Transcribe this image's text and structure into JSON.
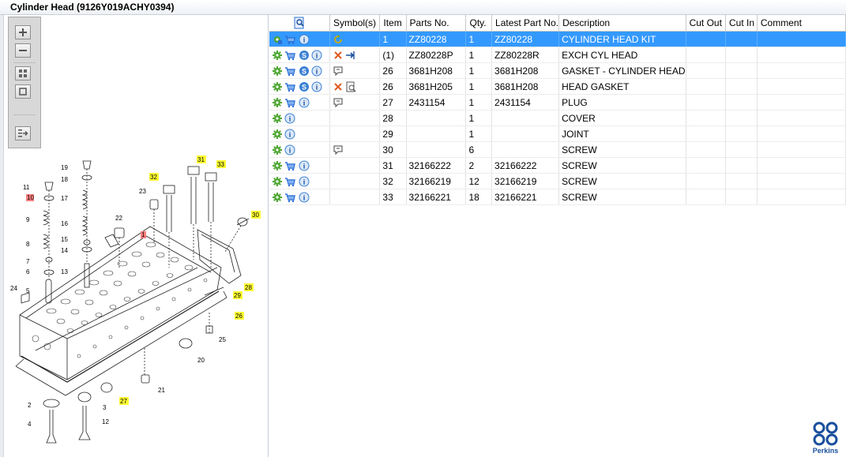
{
  "window": {
    "title": "Cylinder Head (9126Y019ACHY0394)"
  },
  "colors": {
    "selection": "#3399ff",
    "gear": "#4aa52e",
    "cart": "#2b6fd6",
    "info": "#3a7fd4",
    "cross": "#e05a1e",
    "callout_yellow": "#ffff33",
    "callout_red": "#ff8080",
    "perkins": "#1a4f9c"
  },
  "toolbar": {
    "zoom_in_icon": "plus-magnifier-icon",
    "zoom_out_icon": "minus-magnifier-icon",
    "fit_icon": "grid-icon",
    "frame_icon": "square-icon",
    "export_icon": "list-arrow-icon"
  },
  "table": {
    "header_icon": "magnifier-doc-icon",
    "columns": [
      "Symbol(s)",
      "Item",
      "Parts No.",
      "Qty.",
      "Latest Part No.",
      "Description",
      "Cut Out",
      "Cut In",
      "Comment"
    ],
    "rows": [
      {
        "item": "1",
        "part": "ZZ80228",
        "qty": "1",
        "latest": "ZZ80228",
        "desc": "CYLINDER HEAD KIT",
        "cutout": "",
        "cutin": "",
        "comment": ""
      },
      {
        "item": "(1)",
        "part": "ZZ80228P",
        "qty": "1",
        "latest": "ZZ80228R",
        "desc": "EXCH CYL HEAD",
        "cutout": "",
        "cutin": "",
        "comment": ""
      },
      {
        "item": "26",
        "part": "3681H208",
        "qty": "1",
        "latest": "3681H208",
        "desc": "GASKET - CYLINDER HEAD",
        "cutout": "",
        "cutin": "",
        "comment": ""
      },
      {
        "item": "26",
        "part": "3681H205",
        "qty": "1",
        "latest": "3681H208",
        "desc": "HEAD GASKET",
        "cutout": "",
        "cutin": "",
        "comment": ""
      },
      {
        "item": "27",
        "part": "2431154",
        "qty": "1",
        "latest": "2431154",
        "desc": "PLUG",
        "cutout": "",
        "cutin": "",
        "comment": ""
      },
      {
        "item": "28",
        "part": "",
        "qty": "1",
        "latest": "",
        "desc": "COVER",
        "cutout": "",
        "cutin": "",
        "comment": ""
      },
      {
        "item": "29",
        "part": "",
        "qty": "1",
        "latest": "",
        "desc": "JOINT",
        "cutout": "",
        "cutin": "",
        "comment": ""
      },
      {
        "item": "30",
        "part": "",
        "qty": "6",
        "latest": "",
        "desc": "SCREW",
        "cutout": "",
        "cutin": "",
        "comment": ""
      },
      {
        "item": "31",
        "part": "32166222",
        "qty": "2",
        "latest": "32166222",
        "desc": "SCREW",
        "cutout": "",
        "cutin": "",
        "comment": ""
      },
      {
        "item": "32",
        "part": "32166219",
        "qty": "12",
        "latest": "32166219",
        "desc": "SCREW",
        "cutout": "",
        "cutin": "",
        "comment": ""
      },
      {
        "item": "33",
        "part": "32166221",
        "qty": "18",
        "latest": "32166221",
        "desc": "SCREW",
        "cutout": "",
        "cutin": "",
        "comment": ""
      }
    ]
  },
  "callouts": {
    "c1": "1",
    "c2": "2",
    "c3": "3",
    "c4": "4",
    "c5": "5",
    "c6": "6",
    "c7": "7",
    "c8": "8",
    "c9": "9",
    "c10": "10",
    "c11": "11",
    "c12": "12",
    "c13": "13",
    "c14": "14",
    "c15": "15",
    "c16": "16",
    "c17": "17",
    "c18": "18",
    "c19": "19",
    "c20": "20",
    "c21": "21",
    "c22": "22",
    "c23": "23",
    "c24": "24",
    "c25": "25",
    "c26": "26",
    "c27": "27",
    "c28": "28",
    "c29": "29",
    "c30": "30",
    "c31": "31",
    "c32": "32",
    "c33": "33"
  },
  "brand": {
    "logo_text": "Perkins"
  }
}
